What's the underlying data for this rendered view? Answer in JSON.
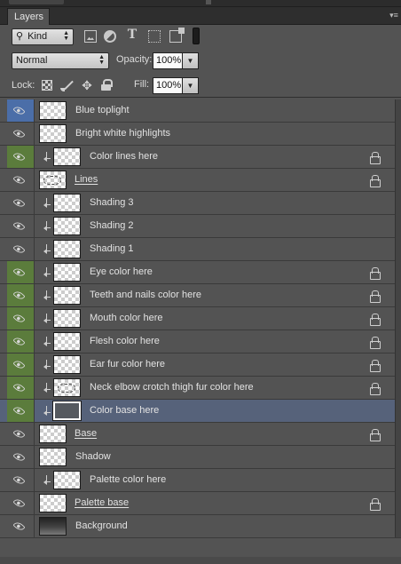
{
  "panel": {
    "tab_label": "Layers",
    "menu_icon": "panel-menu-icon"
  },
  "filter": {
    "kind_label": "Kind",
    "icons": [
      "pixel-filter-icon",
      "adjustment-filter-icon",
      "type-filter-icon",
      "shape-filter-icon",
      "smart-object-filter-icon"
    ],
    "type_glyph": "T"
  },
  "blend": {
    "mode": "Normal",
    "opacity_label": "Opacity:",
    "opacity_value": "100%"
  },
  "locks": {
    "lock_label": "Lock:",
    "fill_label": "Fill:",
    "fill_value": "100%"
  },
  "colors": {
    "green_visibility": "#5b7c3c",
    "blue_visibility": "#4b6ea8",
    "selected_row": "#56627a"
  },
  "layers": [
    {
      "name": "Blue toplight",
      "vis": "blue",
      "clipped": false,
      "locked": false,
      "thumb": "transparent",
      "smart": false
    },
    {
      "name": "Bright white highlights",
      "vis": "none",
      "clipped": false,
      "locked": false,
      "thumb": "transparent",
      "smart": false
    },
    {
      "name": "Color lines here",
      "vis": "green",
      "clipped": true,
      "locked": true,
      "thumb": "transparent",
      "smart": false
    },
    {
      "name": "Lines",
      "vis": "none",
      "clipped": false,
      "locked": true,
      "thumb": "lines",
      "smart": true
    },
    {
      "name": "Shading 3",
      "vis": "none",
      "clipped": true,
      "locked": false,
      "thumb": "transparent",
      "smart": false
    },
    {
      "name": "Shading 2",
      "vis": "none",
      "clipped": true,
      "locked": false,
      "thumb": "transparent",
      "smart": false
    },
    {
      "name": "Shading 1",
      "vis": "none",
      "clipped": true,
      "locked": false,
      "thumb": "transparent",
      "smart": false
    },
    {
      "name": "Eye color here",
      "vis": "green",
      "clipped": true,
      "locked": true,
      "thumb": "transparent",
      "smart": false
    },
    {
      "name": "Teeth and nails color here",
      "vis": "green",
      "clipped": true,
      "locked": true,
      "thumb": "transparent",
      "smart": false
    },
    {
      "name": "Mouth color here",
      "vis": "green",
      "clipped": true,
      "locked": true,
      "thumb": "transparent",
      "smart": false
    },
    {
      "name": "Flesh color here",
      "vis": "green",
      "clipped": true,
      "locked": true,
      "thumb": "transparent",
      "smart": false
    },
    {
      "name": "Ear fur color here",
      "vis": "green",
      "clipped": true,
      "locked": true,
      "thumb": "transparent",
      "smart": false
    },
    {
      "name": "Neck elbow crotch thigh fur color here",
      "vis": "green",
      "clipped": true,
      "locked": true,
      "thumb": "lines",
      "smart": false
    },
    {
      "name": "Color base here",
      "vis": "green",
      "clipped": true,
      "locked": false,
      "thumb": "dark",
      "smart": false,
      "selected": true
    },
    {
      "name": "Base",
      "vis": "none",
      "clipped": false,
      "locked": true,
      "thumb": "transparent",
      "smart": true
    },
    {
      "name": "Shadow",
      "vis": "none",
      "clipped": false,
      "locked": false,
      "thumb": "transparent",
      "smart": false
    },
    {
      "name": "Palette color here",
      "vis": "none",
      "clipped": true,
      "locked": false,
      "thumb": "transparent",
      "smart": false
    },
    {
      "name": "Palette base",
      "vis": "none",
      "clipped": false,
      "locked": true,
      "thumb": "transparent",
      "smart": true
    },
    {
      "name": "Background",
      "vis": "none",
      "clipped": false,
      "locked": false,
      "thumb": "gradient",
      "smart": false
    }
  ]
}
